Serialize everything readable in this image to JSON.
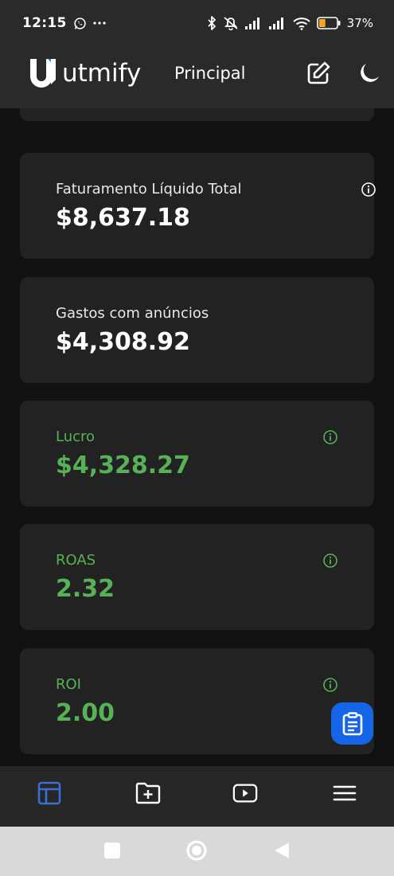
{
  "status_bar": {
    "time": "12:15",
    "battery": "37%",
    "icons": [
      "whatsapp-icon",
      "more-icon",
      "bluetooth-icon",
      "mute-icon",
      "signal-icon",
      "signal-icon",
      "wifi-icon",
      "battery-icon"
    ],
    "battery_level": 0.37,
    "battery_color": "#f5a623"
  },
  "header": {
    "brand": "utmify",
    "page_title": "Principal",
    "edit_icon": "edit-icon",
    "theme_icon": "moon-icon"
  },
  "cards": [
    {
      "label": "Faturamento Líquido Total",
      "value": "$8,637.18",
      "color": "#ffffff",
      "has_info": true
    },
    {
      "label": "Gastos com anúncios",
      "value": "$4,308.92",
      "color": "#ffffff",
      "has_info": false
    },
    {
      "label": "Lucro",
      "value": "$4,328.27",
      "color": "#58b157",
      "has_info": true
    },
    {
      "label": "ROAS",
      "value": "2.32",
      "color": "#58b157",
      "has_info": true
    },
    {
      "label": "ROI",
      "value": "2.00",
      "color": "#58b157",
      "has_info": true
    }
  ],
  "fab": {
    "icon": "clipboard-icon",
    "color": "#1565e8"
  },
  "bottom_nav": {
    "items": [
      "dashboard-icon",
      "add-folder-icon",
      "video-icon",
      "menu-icon"
    ],
    "active_index": 0,
    "active_color": "#3b6fd4"
  },
  "android_nav": [
    "recent-apps-icon",
    "home-icon",
    "back-icon"
  ]
}
